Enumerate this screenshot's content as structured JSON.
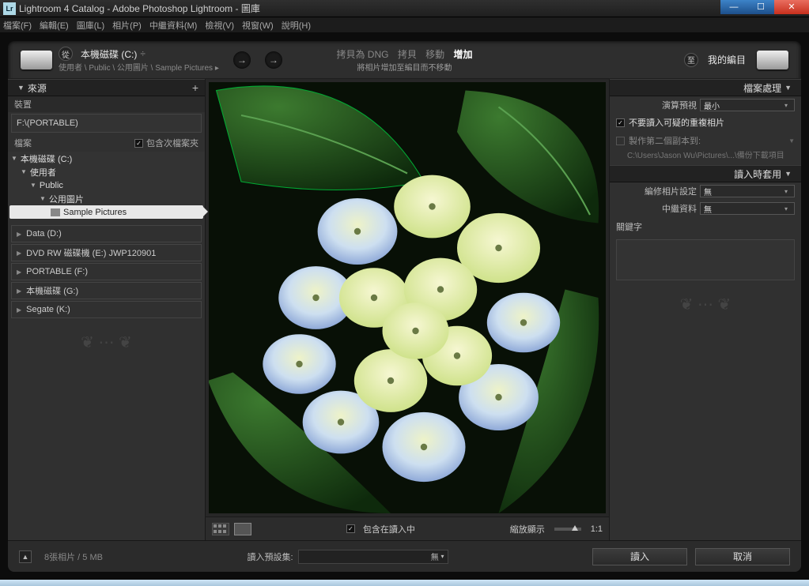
{
  "window": {
    "title": "Lightroom 4 Catalog - Adobe Photoshop Lightroom - 圖庫"
  },
  "menu": [
    "檔案(F)",
    "編輯(E)",
    "圖庫(L)",
    "相片(P)",
    "中繼資料(M)",
    "檢視(V)",
    "視窗(W)",
    "說明(H)"
  ],
  "hdr": {
    "from_badge": "從",
    "from_title": "本機磁碟 (C:)",
    "from_path": "使用者 \\ Public \\ 公用圖片 \\ Sample Pictures ▸",
    "actions": [
      "拷貝為 DNG",
      "拷貝",
      "移動",
      "增加"
    ],
    "action_sub": "將相片增加至編目而不移動",
    "to_badge": "至",
    "to_title": "我的編目"
  },
  "left": {
    "panel_title": "來源",
    "devices_label": "裝置",
    "device": "F:\\(PORTABLE)",
    "files_label": "檔案",
    "include_sub": "包含次檔案夾",
    "tree": {
      "root": "本機磁碟 (C:)",
      "users": "使用者",
      "public": "Public",
      "pubpics": "公用圖片",
      "sample": "Sample Pictures"
    },
    "drives": [
      "Data (D:)",
      "DVD RW 磁碟機 (E:) JWP120901",
      "PORTABLE (F:)",
      "本機磁碟 (G:)",
      "Segate (K:)"
    ]
  },
  "right": {
    "panel1_title": "檔案處理",
    "render_preview_lbl": "演算預視",
    "render_preview_val": "最小",
    "no_dup": "不要讀入可疑的重複相片",
    "second_copy": "製作第二個副本到:",
    "second_copy_path": "C:\\Users\\Jason Wu\\Pictures\\...\\備份下載項目",
    "panel2_title": "讀入時套用",
    "develop_lbl": "編修相片設定",
    "develop_val": "無",
    "metadata_lbl": "中繼資料",
    "metadata_val": "無",
    "keywords_lbl": "關鍵字"
  },
  "mid": {
    "include_importing": "包含在讀入中",
    "thumb_label": "縮放顯示",
    "ratio": "1:1"
  },
  "footer": {
    "status": "8張相片 / 5 MB",
    "preset_lbl": "讀入預設集:",
    "preset_val": "無",
    "import_btn": "讀入",
    "cancel_btn": "取消"
  }
}
